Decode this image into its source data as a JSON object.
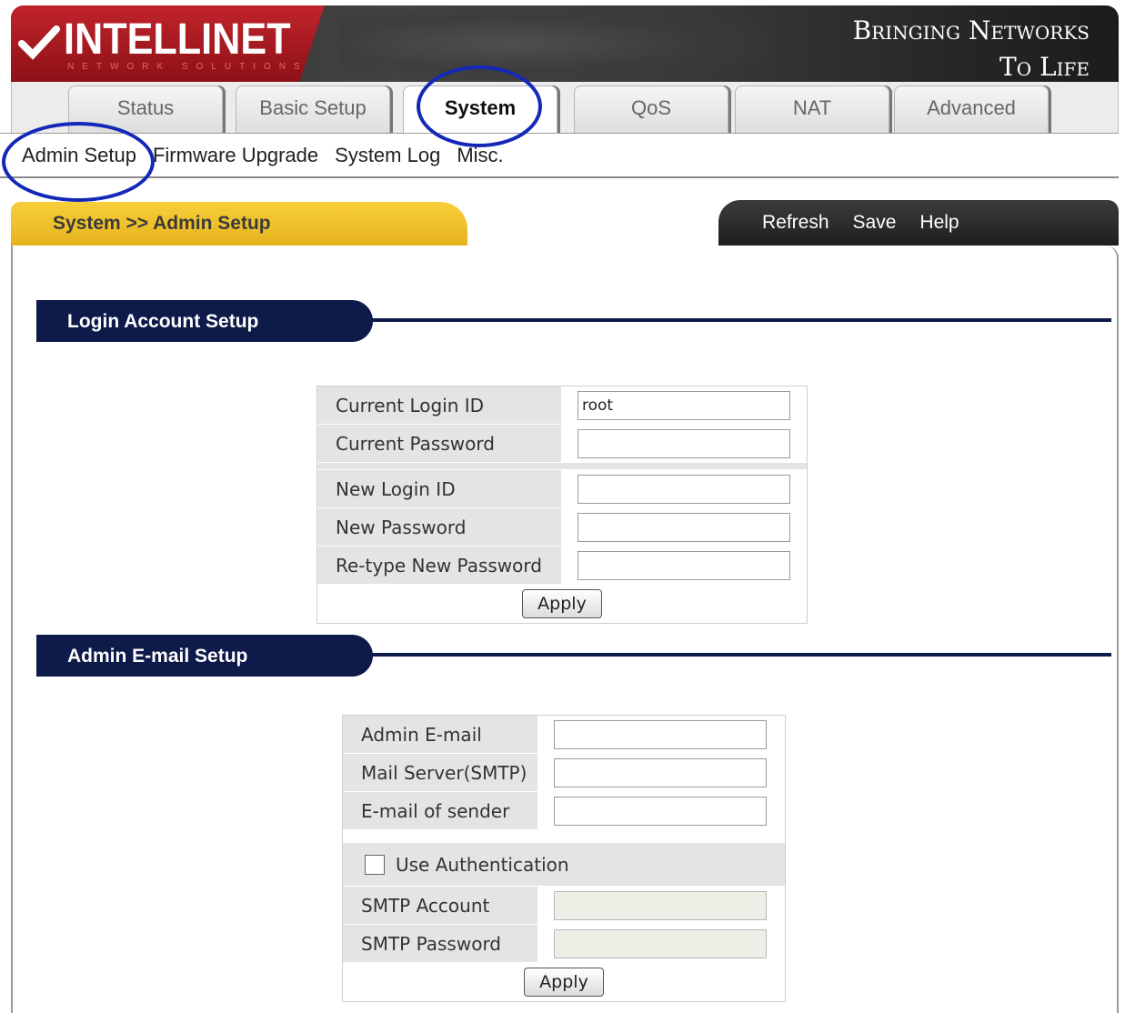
{
  "header": {
    "logo_text": "INTELLINET",
    "logo_subtext": "NETWORK SOLUTIONS",
    "slogan_line1": "Bringing Networks",
    "slogan_line2": "To Life"
  },
  "tabs": [
    {
      "label": "Status"
    },
    {
      "label": "Basic Setup"
    },
    {
      "label": "System"
    },
    {
      "label": "QoS"
    },
    {
      "label": "NAT"
    },
    {
      "label": "Advanced"
    }
  ],
  "subnav": [
    {
      "label": "Admin Setup"
    },
    {
      "label": "Firmware Upgrade"
    },
    {
      "label": "System Log"
    },
    {
      "label": "Misc."
    }
  ],
  "breadcrumb": "System >> Admin Setup",
  "actions": {
    "refresh": "Refresh",
    "save": "Save",
    "help": "Help"
  },
  "login_section": {
    "title": "Login Account Setup",
    "current_login_id_label": "Current Login ID",
    "current_login_id_value": "root",
    "current_password_label": "Current Password",
    "new_login_id_label": "New Login ID",
    "new_password_label": "New Password",
    "retype_password_label": "Re-type New Password",
    "apply_label": "Apply"
  },
  "email_section": {
    "title": "Admin E-mail Setup",
    "admin_email_label": "Admin E-mail",
    "mail_server_label": "Mail Server(SMTP)",
    "sender_email_label": "E-mail of sender",
    "use_auth_label": "Use Authentication",
    "smtp_account_label": "SMTP Account",
    "smtp_password_label": "SMTP Password",
    "apply_label": "Apply"
  },
  "colors": {
    "highlight": "#1428b8",
    "section_navy": "#0e1a4a",
    "breadcrumb_yellow": "#f2c42d",
    "logo_red": "#c0242a"
  }
}
